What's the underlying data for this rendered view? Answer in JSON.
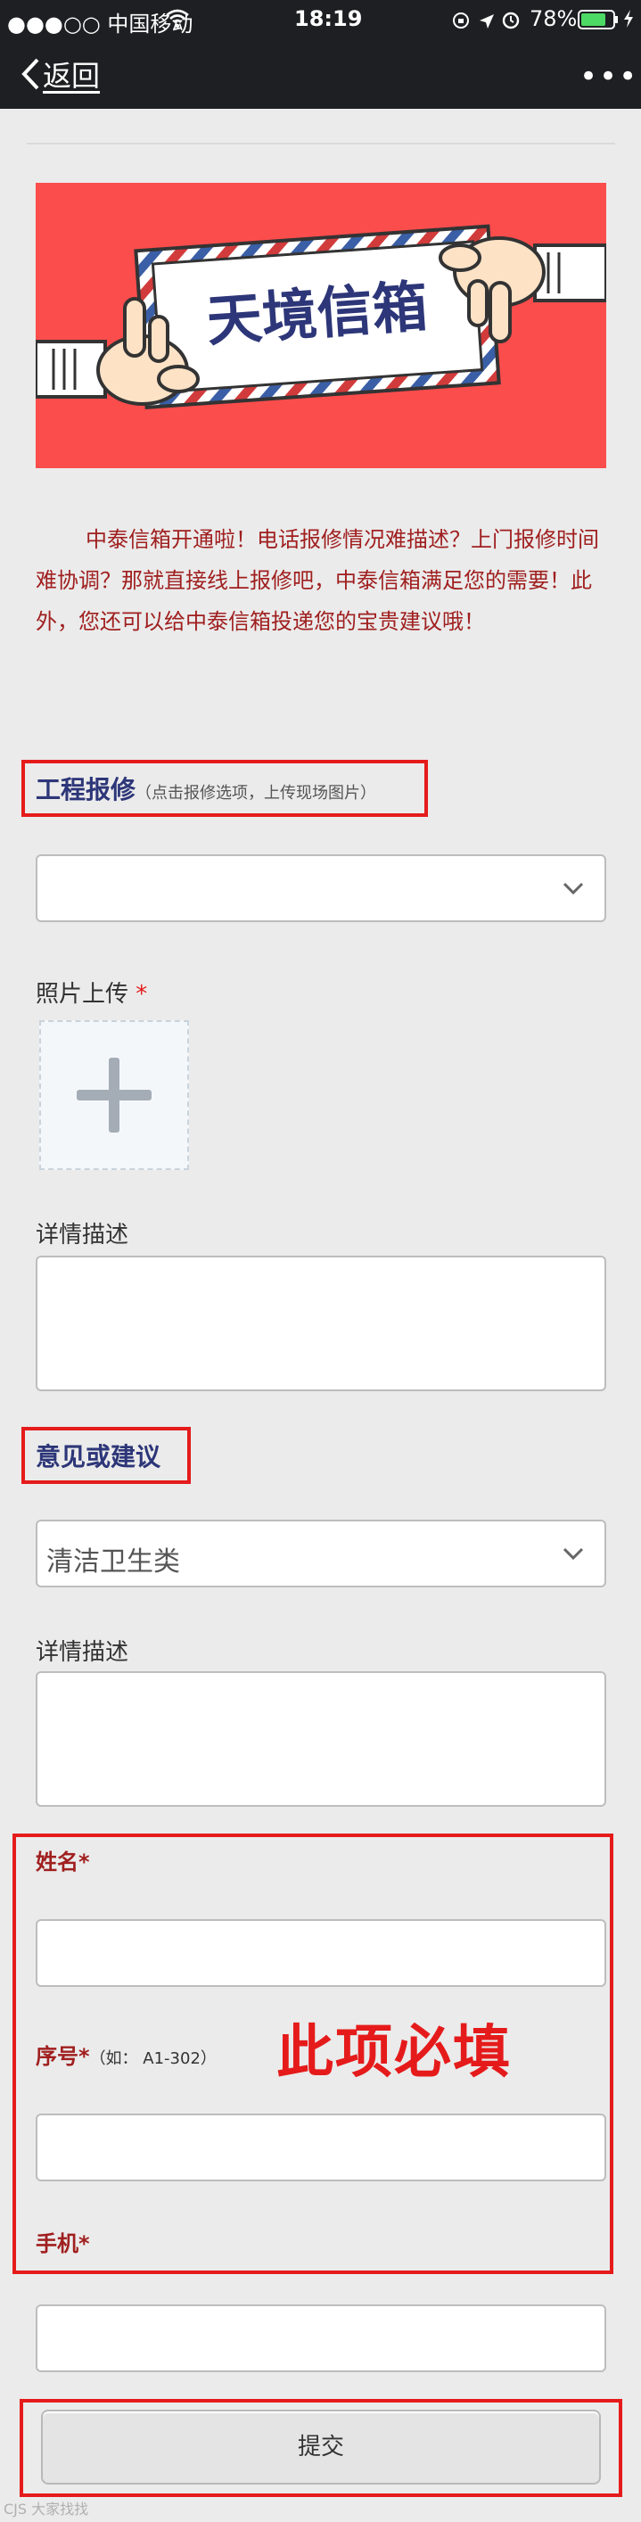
{
  "status_bar": {
    "carrier": "●●●○○ 中国移动",
    "time": "18:19",
    "battery": "78%"
  },
  "nav": {
    "back_label": "返回",
    "more_label": "•••"
  },
  "banner": {
    "title": "天境信箱",
    "background_color": "#fb4d4c"
  },
  "intro_text": "中泰信箱开通啦！电话报修情况难描述？上门报修时间难协调？那就直接线上报修吧，中泰信箱满足您的需要！此外，您还可以给中泰信箱投递您的宝贵建议哦！",
  "repair_section": {
    "title": "工程报修",
    "hint": "（点击报修选项，上传现场图片）",
    "select_value": "",
    "photo_label": "照片上传",
    "photo_required": "*",
    "detail_label": "详情描述",
    "detail_value": ""
  },
  "suggest_section": {
    "title": "意见或建议",
    "select_value": "清洁卫生类",
    "detail_label": "详情描述",
    "detail_value": ""
  },
  "contact_section": {
    "name_label": "姓名*",
    "name_value": "",
    "seq_label": "序号*",
    "seq_hint": "（如： A1-302）",
    "seq_value": "",
    "phone_label": "手机*",
    "phone_value": "",
    "required_note": "此项必填"
  },
  "submit_label": "提交",
  "watermark": "CJS 大家找找",
  "colors": {
    "highlight_border": "#e51b1b",
    "section_title": "#2d3678",
    "intro_text": "#a01f1f"
  }
}
